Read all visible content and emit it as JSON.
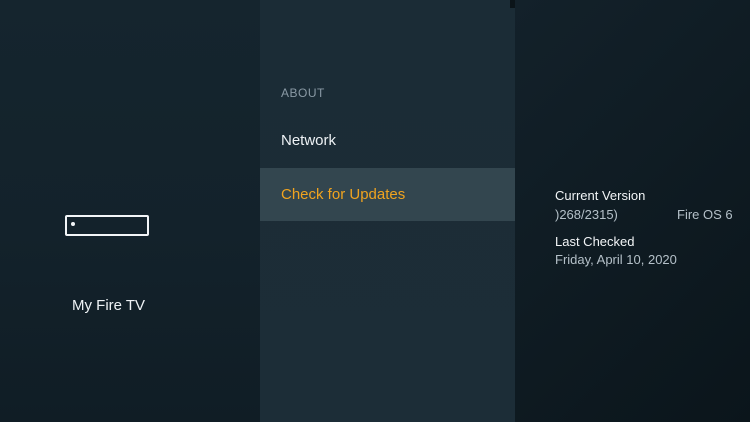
{
  "device": {
    "label": "My Fire TV",
    "icon": "fire-tv-stick-icon"
  },
  "menu": {
    "section_header": "ABOUT",
    "items": [
      {
        "label": "Network",
        "selected": false
      },
      {
        "label": "Check for Updates",
        "selected": true
      }
    ]
  },
  "details": {
    "current_version_label": "Current Version",
    "build_value": ")268/2315)",
    "os_value": "Fire OS 6",
    "last_checked_label": "Last Checked",
    "last_checked_value": "Friday, April 10, 2020"
  },
  "colors": {
    "highlight_text": "#f0a31f",
    "selected_row": "#33464f"
  }
}
